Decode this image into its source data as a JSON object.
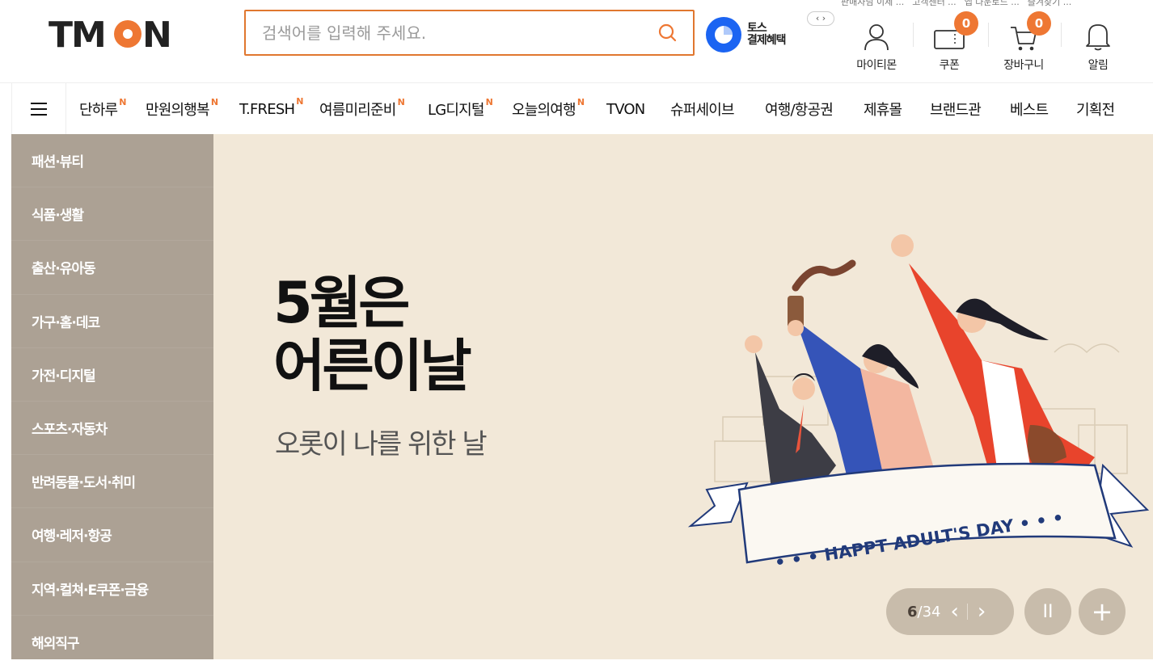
{
  "header": {
    "top_strip": [
      "판매자님 이제 ...",
      "고객센터 ...",
      "앱 다운로드 ...",
      "즐겨찾기 ..."
    ],
    "logo_text": "TMON",
    "search": {
      "placeholder": "검색어를 입력해 주세요."
    },
    "toss": {
      "line1": "토스",
      "line2": "결제혜택",
      "arrows": "‹ ›"
    },
    "utils": [
      {
        "label": "마이티몬",
        "icon": "user-icon"
      },
      {
        "label": "쿠폰",
        "icon": "coupon-icon",
        "badge": "0"
      },
      {
        "label": "장바구니",
        "icon": "cart-icon",
        "badge": "0"
      },
      {
        "label": "알림",
        "icon": "bell-icon"
      }
    ]
  },
  "nav": {
    "items": [
      {
        "label": "단하루",
        "new": "N"
      },
      {
        "label": "만원의행복",
        "new": "N"
      },
      {
        "label": "T.FRESH",
        "new": "N"
      },
      {
        "label": "여름미리준비",
        "new": "N"
      },
      {
        "label": "LG디지털",
        "new": "N"
      },
      {
        "label": "오늘의여행",
        "new": "N"
      },
      {
        "label": "TVON",
        "new": ""
      },
      {
        "label": "슈퍼세이브",
        "new": ""
      },
      {
        "label": "여행/항공권",
        "new": ""
      },
      {
        "label": "제휴몰",
        "new": ""
      },
      {
        "label": "브랜드관",
        "new": ""
      },
      {
        "label": "베스트",
        "new": ""
      },
      {
        "label": "기획전",
        "new": ""
      }
    ]
  },
  "sidebar": {
    "categories": [
      "패션·뷰티",
      "식품·생활",
      "출산·유아동",
      "가구·홈·데코",
      "가전·디지털",
      "스포츠·자동차",
      "반려동물·도서·취미",
      "여행·레저·항공",
      "지역·컬쳐·E쿠폰·금융",
      "해외직구"
    ]
  },
  "banner": {
    "headline_line1": "5월은",
    "headline_line2": "어른이날",
    "subtitle": "오롯이 나를 위한 날",
    "ribbon_text": "• • •  HAPPT ADULT'S DAY • • •",
    "pager_current": "6",
    "pager_total": "/34",
    "pause_label": "II",
    "plus_label": "+"
  },
  "colors": {
    "accent": "#ee7733",
    "sidebar_bg": "#aca194",
    "banner_bg": "#f2e8d8"
  }
}
